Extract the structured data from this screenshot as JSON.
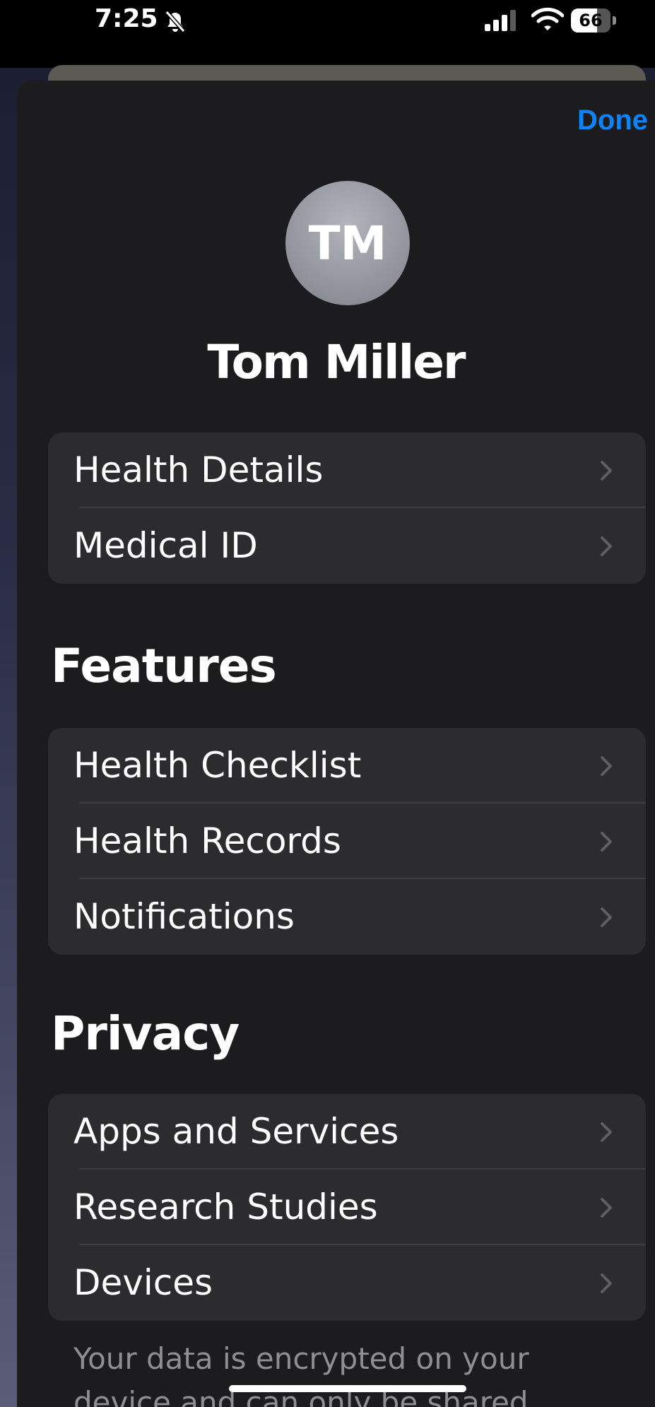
{
  "status_bar": {
    "time": "7:25",
    "battery": "66",
    "battery_level": 66
  },
  "header": {
    "done_label": "Done"
  },
  "profile": {
    "initials": "TM",
    "name": "Tom Miller"
  },
  "account_group": {
    "items": [
      {
        "label": "Health Details"
      },
      {
        "label": "Medical ID"
      }
    ]
  },
  "features": {
    "title": "Features",
    "items": [
      {
        "label": "Health Checklist"
      },
      {
        "label": "Health Records"
      },
      {
        "label": "Notifications"
      }
    ]
  },
  "privacy": {
    "title": "Privacy",
    "items": [
      {
        "label": "Apps and Services"
      },
      {
        "label": "Research Studies"
      },
      {
        "label": "Devices"
      }
    ],
    "footer": "Your data is encrypted on your device and can only be shared"
  },
  "colors": {
    "accent": "#0a84ff",
    "sheet_background": "#1c1c1e",
    "row_background": "#2c2c2e",
    "secondary_text": "#8e8e93"
  },
  "icons": {
    "mute": "bell-slash-icon",
    "signal": "cellular-signal-icon",
    "wifi": "wifi-icon",
    "battery": "battery-icon",
    "chevron": "chevron-right-icon"
  }
}
